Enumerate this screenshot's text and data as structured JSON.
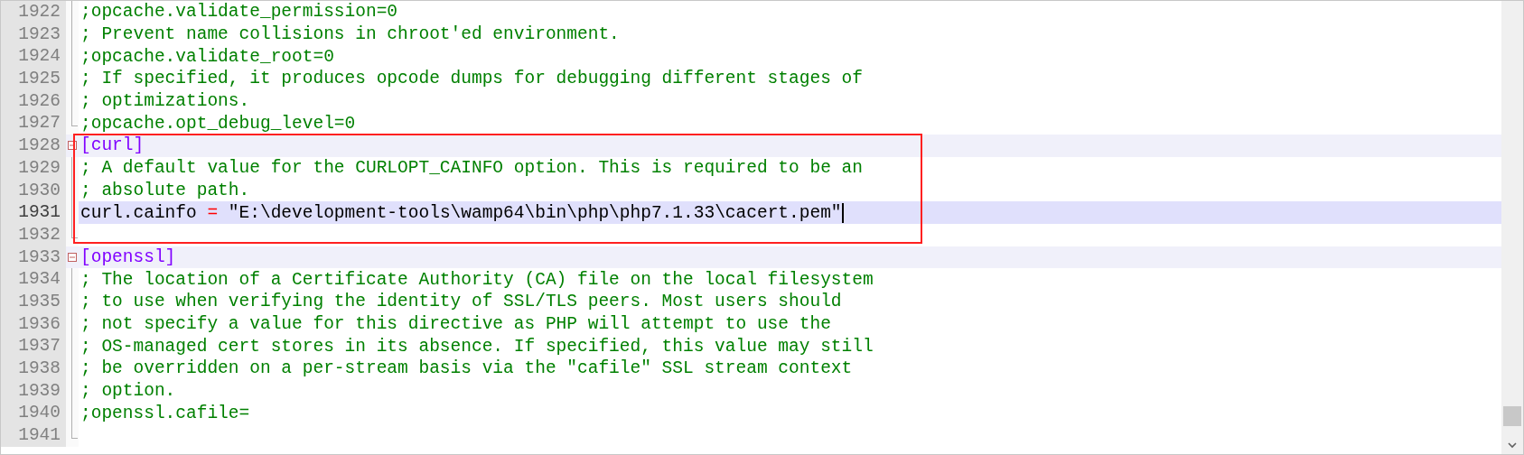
{
  "editor": {
    "lines": [
      {
        "number": "1922",
        "kind": "comment",
        "text": ";opcache.validate_permission=0",
        "current": false
      },
      {
        "number": "1923",
        "kind": "comment",
        "text": "; Prevent name collisions in chroot'ed environment.",
        "current": false
      },
      {
        "number": "1924",
        "kind": "comment",
        "text": ";opcache.validate_root=0",
        "current": false
      },
      {
        "number": "1925",
        "kind": "comment",
        "text": "; If specified, it produces opcode dumps for debugging different stages of",
        "current": false
      },
      {
        "number": "1926",
        "kind": "comment",
        "text": "; optimizations.",
        "current": false
      },
      {
        "number": "1927",
        "kind": "comment",
        "text": ";opcache.opt_debug_level=0",
        "current": false
      },
      {
        "number": "1928",
        "kind": "section",
        "text": "[curl]",
        "current": false
      },
      {
        "number": "1929",
        "kind": "comment",
        "text": "; A default value for the CURLOPT_CAINFO option. This is required to be an",
        "current": false
      },
      {
        "number": "1930",
        "kind": "comment",
        "text": "; absolute path.",
        "current": false
      },
      {
        "number": "1931",
        "kind": "entry",
        "key": "curl.cainfo ",
        "op": "=",
        "value": " \"E:\\development-tools\\wamp64\\bin\\php\\php7.1.33\\cacert.pem\"",
        "current": true
      },
      {
        "number": "1932",
        "kind": "blank",
        "current": false
      },
      {
        "number": "1933",
        "kind": "section",
        "text": "[openssl]",
        "current": false
      },
      {
        "number": "1934",
        "kind": "comment",
        "text": "; The location of a Certificate Authority (CA) file on the local filesystem",
        "current": false
      },
      {
        "number": "1935",
        "kind": "comment",
        "text": "; to use when verifying the identity of SSL/TLS peers. Most users should",
        "current": false
      },
      {
        "number": "1936",
        "kind": "comment",
        "text": "; not specify a value for this directive as PHP will attempt to use the",
        "current": false
      },
      {
        "number": "1937",
        "kind": "comment",
        "text": "; OS-managed cert stores in its absence. If specified, this value may still",
        "current": false
      },
      {
        "number": "1938",
        "kind": "comment",
        "text": "; be overridden on a per-stream basis via the \"cafile\" SSL stream context",
        "current": false
      },
      {
        "number": "1939",
        "kind": "comment",
        "text": "; option.",
        "current": false
      },
      {
        "number": "1940",
        "kind": "comment",
        "text": ";openssl.cafile=",
        "current": false
      },
      {
        "number": "1941",
        "kind": "blank",
        "current": false
      }
    ]
  }
}
